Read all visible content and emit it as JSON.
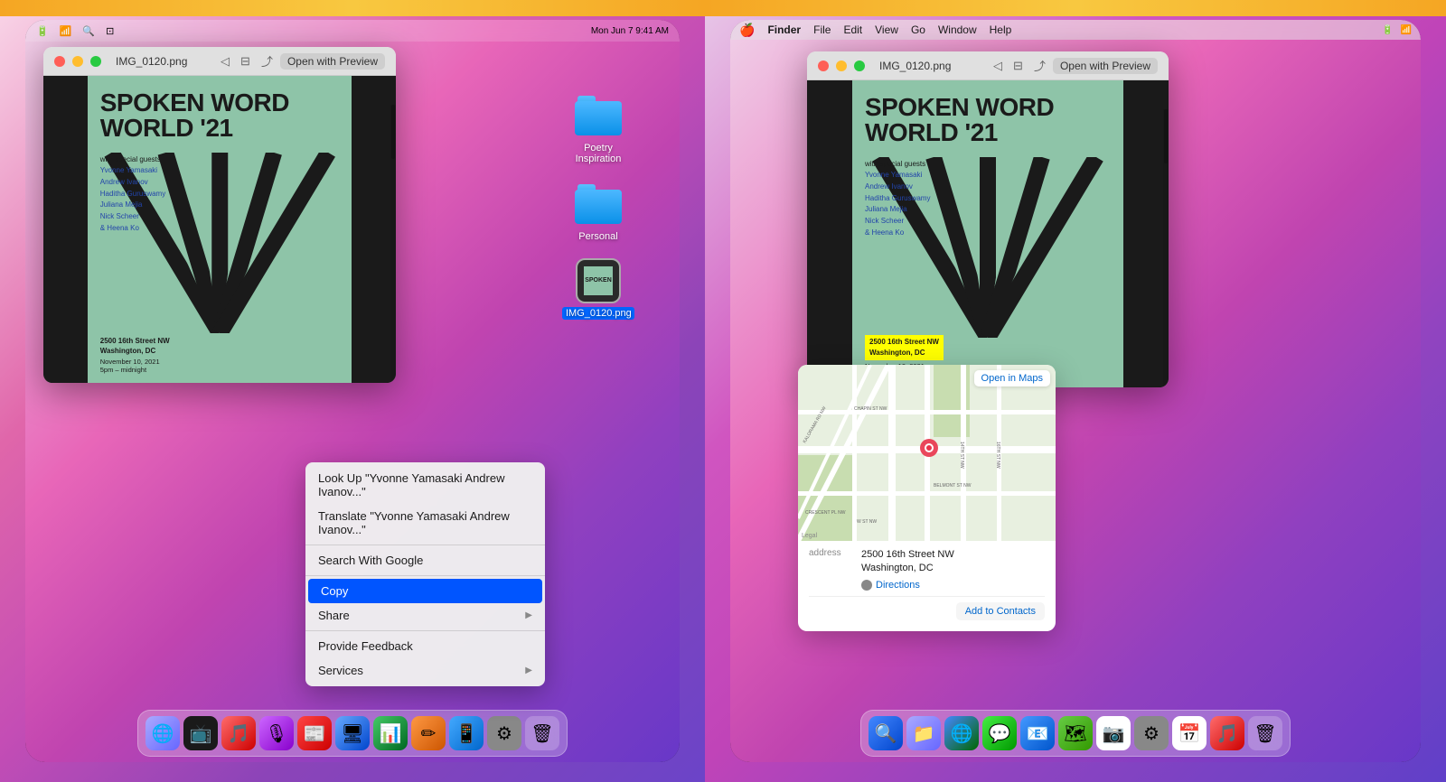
{
  "left": {
    "menubar": {
      "time": "Mon Jun 7  9:41 AM",
      "battery_icon": "🔋",
      "wifi_icon": "wifi",
      "search_icon": "🔍",
      "screen_icon": "⊡"
    },
    "desktop_icons": [
      {
        "name": "Poetry Inspiration",
        "type": "folder",
        "selected": false
      },
      {
        "name": "Personal",
        "type": "folder",
        "selected": false
      },
      {
        "name": "IMG_0120.png",
        "type": "file",
        "selected": true
      }
    ],
    "preview_window": {
      "title": "IMG_0120.png",
      "open_with": "Open with Preview",
      "scrollbar": true
    },
    "poster": {
      "title": "SPOKEN WORD WORLD '21",
      "special_guests": "with special guests",
      "names": [
        "Yvonne Yamasaki",
        "Andrew Ivanov",
        "Haditha Guruswamy",
        "Juliana Mejia",
        "Nick Scheer",
        "& Heena Ko"
      ],
      "address": "2500 16th Street NW\nWashington, DC",
      "date": "November 10, 2021\n5pm – midnight"
    },
    "context_menu": {
      "items": [
        {
          "label": "Look Up \"Yvonne Yamasaki Andrew Ivanov...\"",
          "has_arrow": false,
          "highlighted": false
        },
        {
          "label": "Translate \"Yvonne Yamasaki Andrew Ivanov...\"",
          "has_arrow": false,
          "highlighted": false
        },
        {
          "label": "Search With Google",
          "has_arrow": false,
          "highlighted": false
        },
        {
          "label": "Copy",
          "has_arrow": false,
          "highlighted": true
        },
        {
          "label": "Share",
          "has_arrow": true,
          "highlighted": false
        },
        {
          "label": "Provide Feedback",
          "has_arrow": false,
          "highlighted": false
        },
        {
          "label": "Services",
          "has_arrow": true,
          "highlighted": false
        }
      ]
    },
    "dock": {
      "icons": [
        "🌐",
        "📺",
        "🎵",
        "🎙",
        "📰",
        "🖥",
        "📊",
        "✏",
        "📱",
        "⚙",
        "🗑"
      ]
    }
  },
  "right": {
    "menubar": {
      "apple": "🍎",
      "items": [
        "Finder",
        "File",
        "Edit",
        "View",
        "Go",
        "Window",
        "Help"
      ]
    },
    "preview_window": {
      "title": "IMG_0120.png",
      "open_with": "Open with Preview"
    },
    "poster": {
      "title": "SPOKEN WORD WORLD '21",
      "special_guests": "with special guests",
      "names": [
        "Yvonne Yamasaki",
        "Andrew Ivanov",
        "Haditha Guruswamy",
        "Juliana Mejia",
        "Nick Scheer",
        "& Heena Ko"
      ],
      "address_highlighted": "2500 16th Street NW\nWashington, DC",
      "date": "November 10, 2021\n5pm – midnight"
    },
    "map_popup": {
      "open_in_maps": "Open in Maps",
      "address_label": "address",
      "address_value": "2500 16th Street NW\nWashington, DC",
      "directions": "Directions",
      "add_to_contacts": "Add to Contacts",
      "legal": "Legal"
    },
    "dock": {
      "icons": [
        "🔍",
        "📁",
        "🌐",
        "💬",
        "📧",
        "🗺",
        "📷",
        "⚙",
        "📅",
        "🎵",
        "🗑"
      ]
    }
  }
}
